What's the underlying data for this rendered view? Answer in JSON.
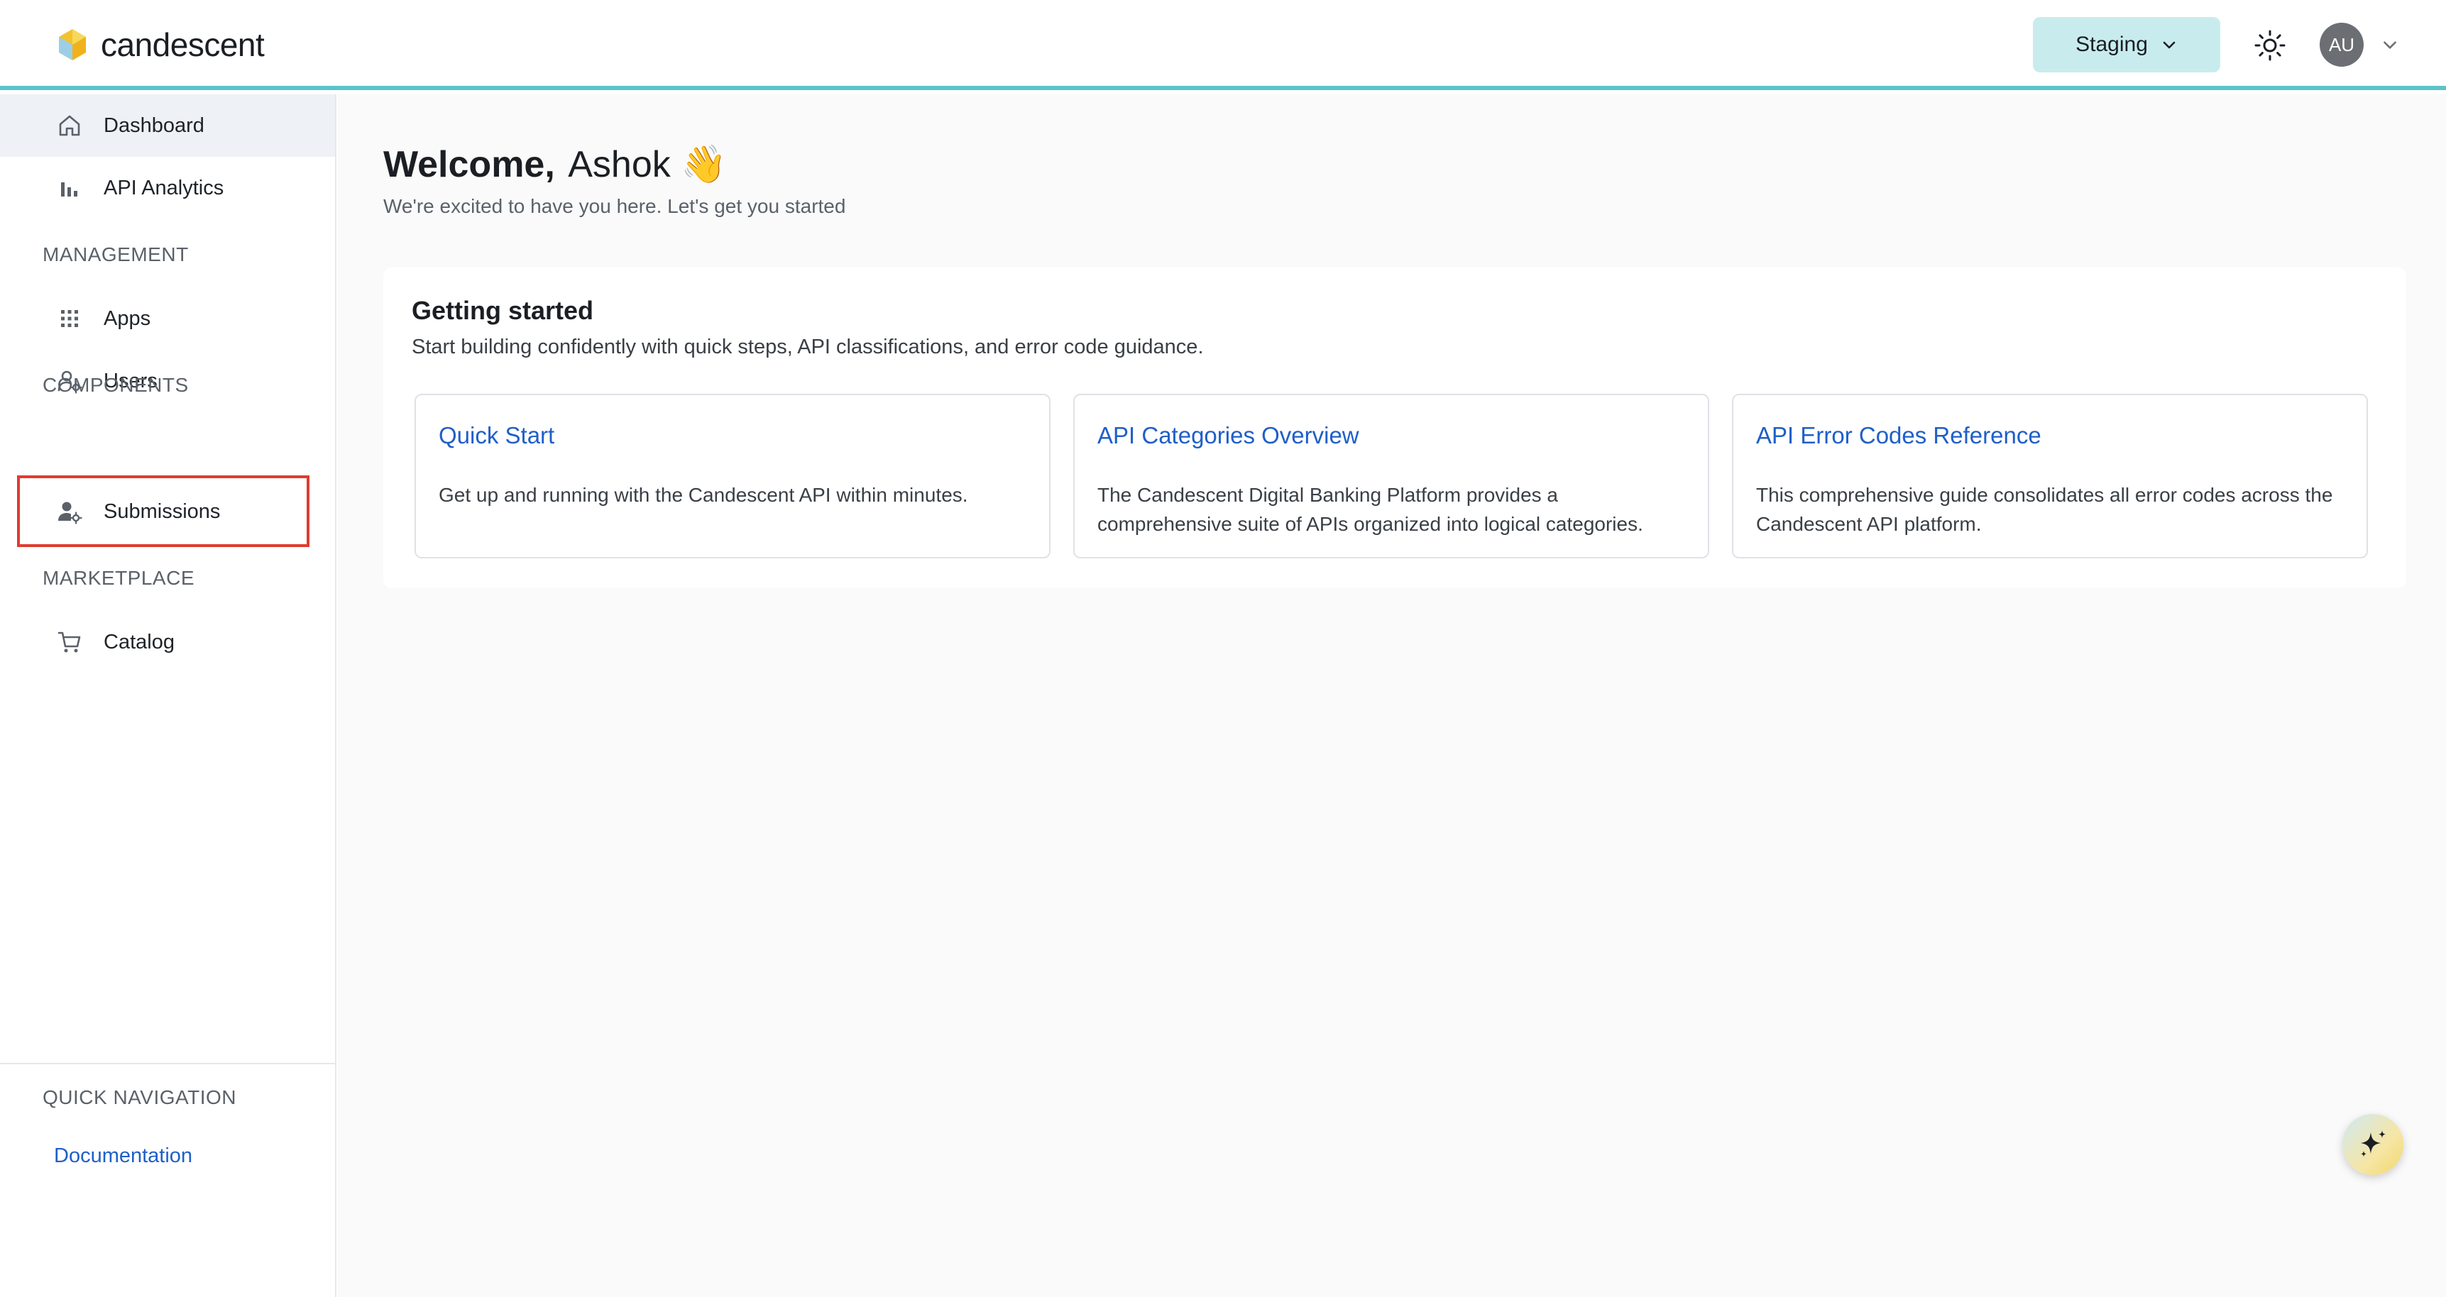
{
  "header": {
    "brand": "candescent",
    "environment": "Staging",
    "avatar_initials": "AU",
    "accent_color": "#5bc3c8"
  },
  "sidebar": {
    "top_items": [
      {
        "label": "Dashboard",
        "icon": "home-icon",
        "active": true
      },
      {
        "label": "API Analytics",
        "icon": "bar-chart-icon",
        "active": false
      }
    ],
    "management_label": "MANAGEMENT",
    "management_items": [
      {
        "label": "Apps",
        "icon": "grid-icon"
      },
      {
        "label": "Users",
        "icon": "user-gear-icon"
      }
    ],
    "components_label": "COMPONENTS",
    "components_items": [
      {
        "label": "Submissions",
        "icon": "user-gear-icon",
        "highlighted": true
      }
    ],
    "marketplace_label": "MARKETPLACE",
    "marketplace_items": [
      {
        "label": "Catalog",
        "icon": "cart-icon"
      }
    ],
    "quick_nav_label": "QUICK NAVIGATION",
    "quick_nav_link": "Documentation"
  },
  "main": {
    "welcome_bold": "Welcome,",
    "welcome_name": "Ashok",
    "welcome_emoji": "👋",
    "subtitle": "We're excited to have you here. Let's get you started",
    "panel": {
      "title": "Getting started",
      "subtitle": "Start building confidently with quick steps, API classifications, and error code guidance.",
      "cards": [
        {
          "title": "Quick Start",
          "description": "Get up and running with the Candescent API within minutes."
        },
        {
          "title": "API Categories Overview",
          "description": "The Candescent Digital Banking Platform provides a comprehensive suite of APIs organized into logical categories."
        },
        {
          "title": "API Error Codes Reference",
          "description": "This comprehensive guide consolidates all error codes across the Candescent API platform."
        }
      ]
    }
  },
  "fab": {
    "icon": "sparkle-icon"
  }
}
